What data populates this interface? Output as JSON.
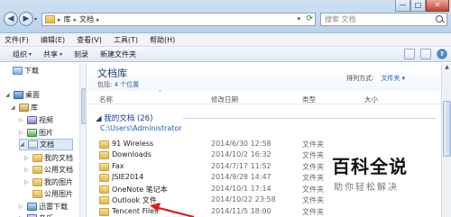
{
  "window": {
    "breadcrumb": [
      "库",
      "文档"
    ],
    "search_placeholder": "搜索 文档",
    "controls": {
      "minimize": "—",
      "maximize": "□",
      "close": "✕"
    }
  },
  "menu": [
    "文件(F)",
    "编辑(E)",
    "查看(V)",
    "工具(T)",
    "帮助(H)"
  ],
  "toolbar": {
    "organize": "组织",
    "share": "共享",
    "burn": "刻录",
    "new_folder": "新建文件夹"
  },
  "nav_pane": {
    "items": [
      {
        "label": "下载",
        "icon": "download-icon",
        "expander": ""
      },
      {
        "label": "桌面",
        "icon": "desktop-icon",
        "expander": "◢"
      },
      {
        "label": "库",
        "icon": "library-icon",
        "expander": "◢"
      },
      {
        "label": "视频",
        "icon": "video-folder-icon",
        "expander": "▷"
      },
      {
        "label": "图片",
        "icon": "picture-folder-icon",
        "expander": "▷"
      },
      {
        "label": "文档",
        "icon": "documents-icon",
        "expander": "◢",
        "selected": true
      },
      {
        "label": "我的文档",
        "icon": "folder-icon",
        "expander": "▷"
      },
      {
        "label": "公用文档",
        "icon": "folder-icon",
        "expander": "▷"
      },
      {
        "label": "我的图片",
        "icon": "folder-icon",
        "expander": "▷"
      },
      {
        "label": "公用图片",
        "icon": "folder-icon",
        "expander": ""
      },
      {
        "label": "迅雷下载",
        "icon": "thunder-download-icon",
        "expander": "▷"
      },
      {
        "label": "音乐",
        "icon": "music-icon",
        "expander": "▷"
      }
    ]
  },
  "library": {
    "title": "文档库",
    "includes_prefix": "包括: ",
    "includes_link": "4 个位置",
    "arrange_label": "排列方式:",
    "arrange_value": "文件夹 ▾"
  },
  "columns": {
    "name": "名称",
    "date": "修改日期",
    "type": "类型",
    "size": "大小"
  },
  "group": {
    "header": "我的文档 (26)",
    "path": "C:\\Users\\Administrator"
  },
  "files": [
    {
      "name": "91 Wireless",
      "date": "2014/6/30 12:58",
      "type": "文件夹"
    },
    {
      "name": "Downloads",
      "date": "2014/10/2 16:32",
      "type": "文件夹"
    },
    {
      "name": "Fax",
      "date": "2014/7/17 11:52",
      "type": "文件夹"
    },
    {
      "name": "JSIE2014",
      "date": "2014/9/28 14:47",
      "type": "文件夹"
    },
    {
      "name": "OneNote 笔记本",
      "date": "2014/10/1 17:14",
      "type": "文件夹"
    },
    {
      "name": "Outlook 文件",
      "date": "2014/10/22 23:58",
      "type": "文件夹"
    },
    {
      "name": "Tencent Files",
      "date": "2014/11/5 18:00",
      "type": "文件夹"
    }
  ],
  "watermark": {
    "title": "百科全说",
    "subtitle": "助你轻松解决"
  }
}
